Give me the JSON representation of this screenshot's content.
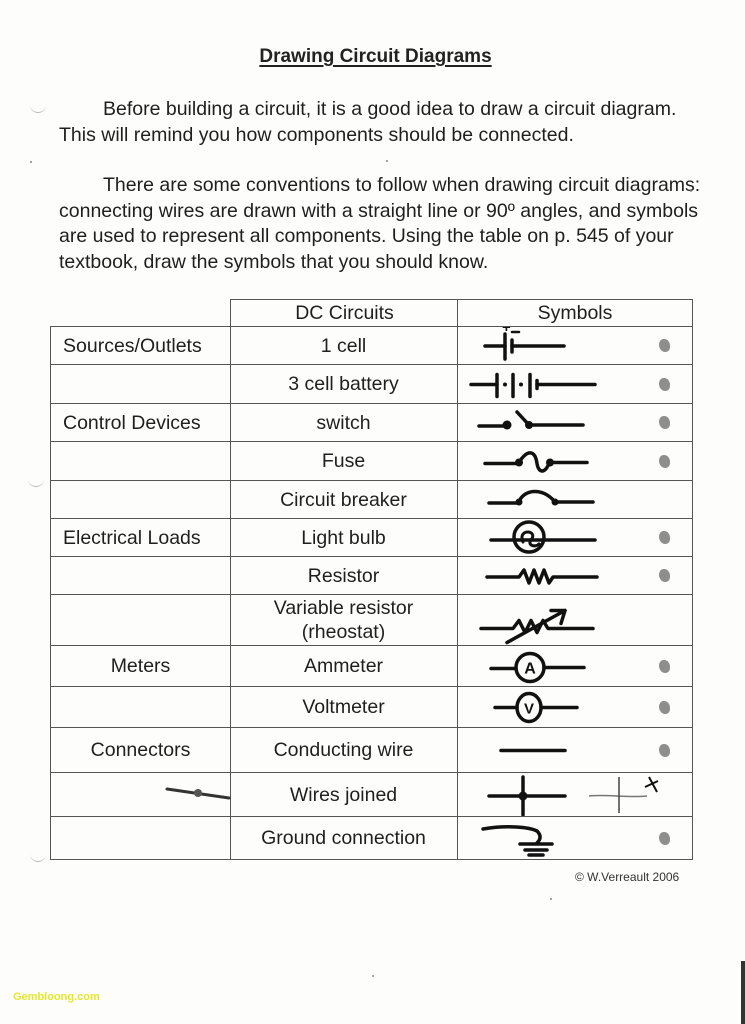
{
  "document": {
    "title": "Drawing Circuit Diagrams",
    "paragraphs": [
      "Before building a circuit, it is a good idea to draw a circuit diagram.  This will remind you how components should be connected.",
      "There are some conventions to follow when drawing circuit diagrams: connecting wires are drawn with a straight line or 90º angles, and symbols are used to represent all components. Using the table on p. 545 of your textbook, draw the symbols that you should know."
    ],
    "copyright": "© W.Verreault 2006",
    "watermark": "Gembloong.com"
  },
  "table": {
    "headers": [
      "",
      "DC Circuits",
      "Symbols"
    ],
    "rows": [
      {
        "category": "Sources/Outlets",
        "item": "1 cell",
        "symbol": "cell-symbol",
        "marked": true
      },
      {
        "category": "",
        "item": "3 cell battery",
        "symbol": "battery-symbol",
        "marked": true
      },
      {
        "category": "Control Devices",
        "item": "switch",
        "symbol": "switch-symbol",
        "marked": true
      },
      {
        "category": "",
        "item": "Fuse",
        "symbol": "fuse-symbol",
        "marked": true
      },
      {
        "category": "",
        "item": "Circuit breaker",
        "symbol": "circuit-breaker-symbol",
        "marked": false
      },
      {
        "category": "Electrical Loads",
        "item": "Light bulb",
        "symbol": "light-bulb-symbol",
        "marked": true
      },
      {
        "category": "",
        "item": "Resistor",
        "symbol": "resistor-symbol",
        "marked": true
      },
      {
        "category": "",
        "item": "Variable resistor (rheostat)",
        "item_lines": [
          "Variable resistor",
          "(rheostat)"
        ],
        "symbol": "rheostat-symbol",
        "marked": false
      },
      {
        "category": "Meters",
        "item": "Ammeter",
        "symbol": "ammeter-symbol",
        "marked": true
      },
      {
        "category": "",
        "item": "Voltmeter",
        "symbol": "voltmeter-symbol",
        "marked": true
      },
      {
        "category": "Connectors",
        "item": "Conducting wire",
        "symbol": "wire-symbol",
        "marked": true
      },
      {
        "category": "",
        "item": "Wires joined",
        "symbol": "wires-joined-symbol",
        "marked": false
      },
      {
        "category": "",
        "item": "Ground connection",
        "symbol": "ground-symbol",
        "marked": true
      }
    ],
    "symbol_annotations": {
      "cell_plus": "+",
      "cell_minus": "-",
      "ammeter_letter": "A",
      "voltmeter_letter": "V"
    }
  }
}
